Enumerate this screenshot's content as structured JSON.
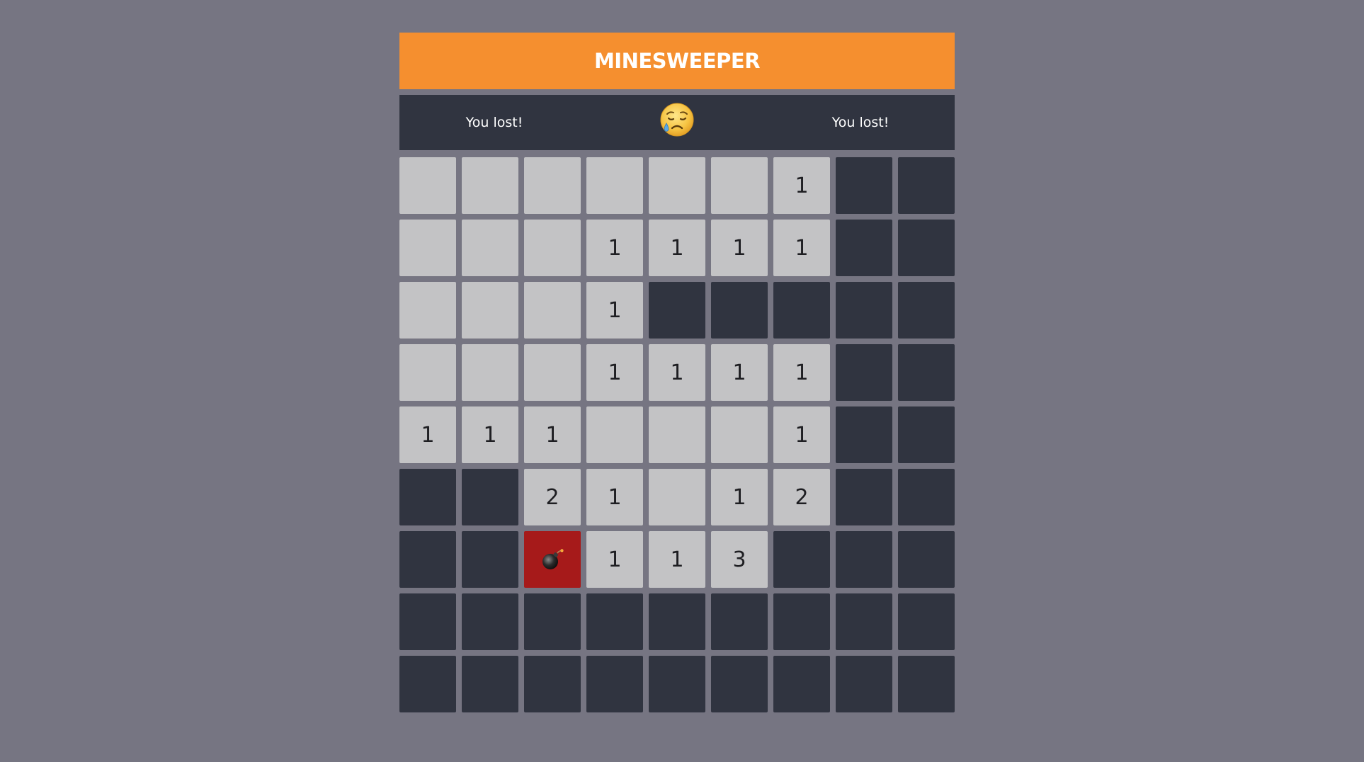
{
  "header": {
    "title": "MINESWEEPER"
  },
  "status": {
    "left_text": "You lost!",
    "right_text": "You lost!",
    "face_icon": "sad-tear-face"
  },
  "colors": {
    "background": "#767582",
    "header": "#f58f2f",
    "status_bar": "#303440",
    "hidden_cell": "#303440",
    "open_cell": "#c3c3c5",
    "exploded_mine_cell": "#a61a1a"
  },
  "board": {
    "cols": 9,
    "rows": 9,
    "legend": "H = hidden, 0 = open empty, 1-8 = open number, M = exploded mine",
    "grid": [
      [
        "0",
        "0",
        "0",
        "0",
        "0",
        "0",
        "1",
        "H",
        "H"
      ],
      [
        "0",
        "0",
        "0",
        "1",
        "1",
        "1",
        "1",
        "H",
        "H"
      ],
      [
        "0",
        "0",
        "0",
        "1",
        "H",
        "H",
        "H",
        "H",
        "H"
      ],
      [
        "0",
        "0",
        "0",
        "1",
        "1",
        "1",
        "1",
        "H",
        "H"
      ],
      [
        "1",
        "1",
        "1",
        "0",
        "0",
        "0",
        "1",
        "H",
        "H"
      ],
      [
        "H",
        "H",
        "2",
        "1",
        "0",
        "1",
        "2",
        "H",
        "H"
      ],
      [
        "H",
        "H",
        "M",
        "1",
        "1",
        "3",
        "H",
        "H",
        "H"
      ],
      [
        "H",
        "H",
        "H",
        "H",
        "H",
        "H",
        "H",
        "H",
        "H"
      ],
      [
        "H",
        "H",
        "H",
        "H",
        "H",
        "H",
        "H",
        "H",
        "H"
      ]
    ]
  }
}
